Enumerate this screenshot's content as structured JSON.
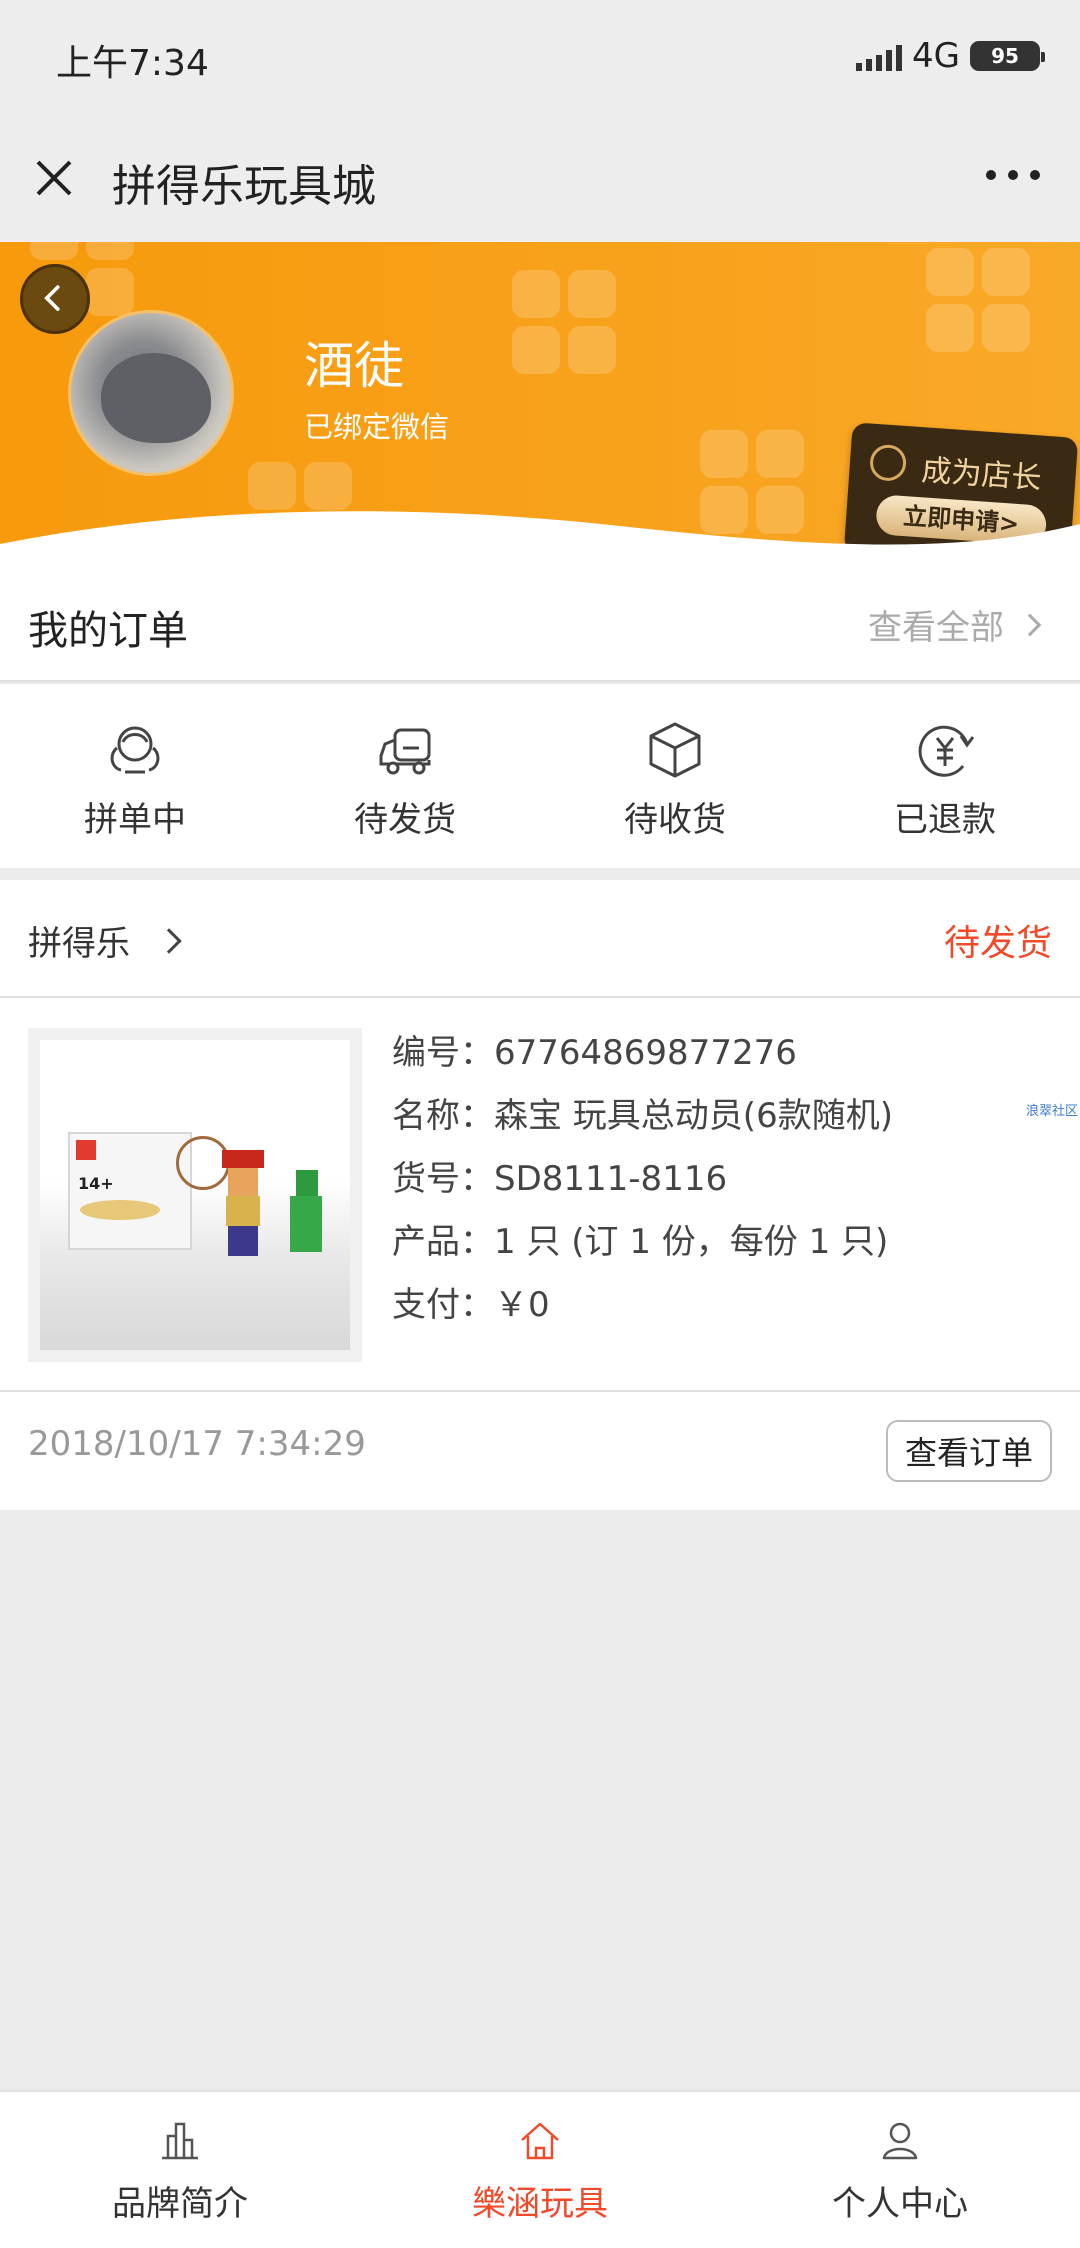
{
  "status_bar": {
    "time": "上午7:34",
    "network": "4G",
    "battery": "95"
  },
  "title_bar": {
    "title": "拼得乐玩具城"
  },
  "profile": {
    "name": "酒徒",
    "subtitle": "已绑定微信",
    "shop_badge_title": "成为店长",
    "shop_badge_action": "立即申请>"
  },
  "orders": {
    "title": "我的订单",
    "view_all": "查看全部",
    "status_tabs": [
      {
        "label": "拼单中",
        "icon": "group-icon"
      },
      {
        "label": "待发货",
        "icon": "truck-icon"
      },
      {
        "label": "待收货",
        "icon": "package-icon"
      },
      {
        "label": "已退款",
        "icon": "refund-icon"
      }
    ]
  },
  "order": {
    "store": "拼得乐",
    "status": "待发货",
    "details": [
      "编号：67764869877276",
      "名称：森宝 玩具总动员(6款随机)",
      "货号：SD8111-8116",
      "产品：1 只 (订 1 份，每份 1 只)",
      "支付：￥0"
    ],
    "tiny_tag": "浪翠社区",
    "box_age": "14+",
    "time": "2018/10/17 7:34:29",
    "view_button": "查看订单"
  },
  "tab_bar": {
    "items": [
      {
        "label": "品牌简介",
        "icon": "building-icon"
      },
      {
        "label": "樂涵玩具",
        "icon": "home-icon",
        "active": true
      },
      {
        "label": "个人中心",
        "icon": "user-icon"
      }
    ]
  },
  "colors": {
    "accent": "#f04a2a",
    "banner": "#f79a0c",
    "background": "#ebebeb"
  }
}
